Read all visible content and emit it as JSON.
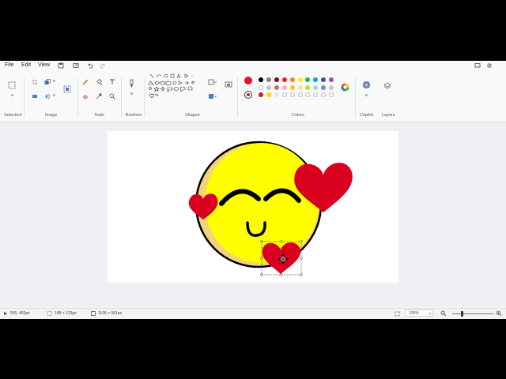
{
  "menu": {
    "file": "File",
    "edit": "Edit",
    "view": "View"
  },
  "ribbon": {
    "groups": {
      "selection": "Selection",
      "image": "Image",
      "tools": "Tools",
      "brushes": "Brushes",
      "shapes": "Shapes",
      "colors": "Colors",
      "copilot": "Copilot",
      "layers": "Layers"
    },
    "current_colors": {
      "primary": "#e3102a",
      "secondary": "#ffffff"
    },
    "palette_row1": [
      "#000000",
      "#7f7f7f",
      "#880015",
      "#ed1c24",
      "#ff7f27",
      "#fff200",
      "#22b14c",
      "#00a2e8",
      "#3f48cc",
      "#a349a4"
    ],
    "palette_row2": [
      "#ffffff",
      "#c3c3c3",
      "#b97a57",
      "#ffaec9",
      "#ffc90e",
      "#efe4b0",
      "#b5e61d",
      "#99d9ea",
      "#7092be",
      "#c8bfe7"
    ],
    "palette_row3": [
      "#e3102a",
      "#ffd700",
      "#e3e3e3",
      "",
      "",
      "",
      "",
      "",
      "",
      ""
    ]
  },
  "status": {
    "cursor_pos": "555, 465px",
    "selection_size": "148 × 123px",
    "canvas_size": "1106 × 581px",
    "zoom": "100%"
  },
  "colors": {
    "heart": "#d9001f",
    "face": "#ffff00",
    "face_rim": "#f5d37a",
    "outline": "#000000"
  }
}
